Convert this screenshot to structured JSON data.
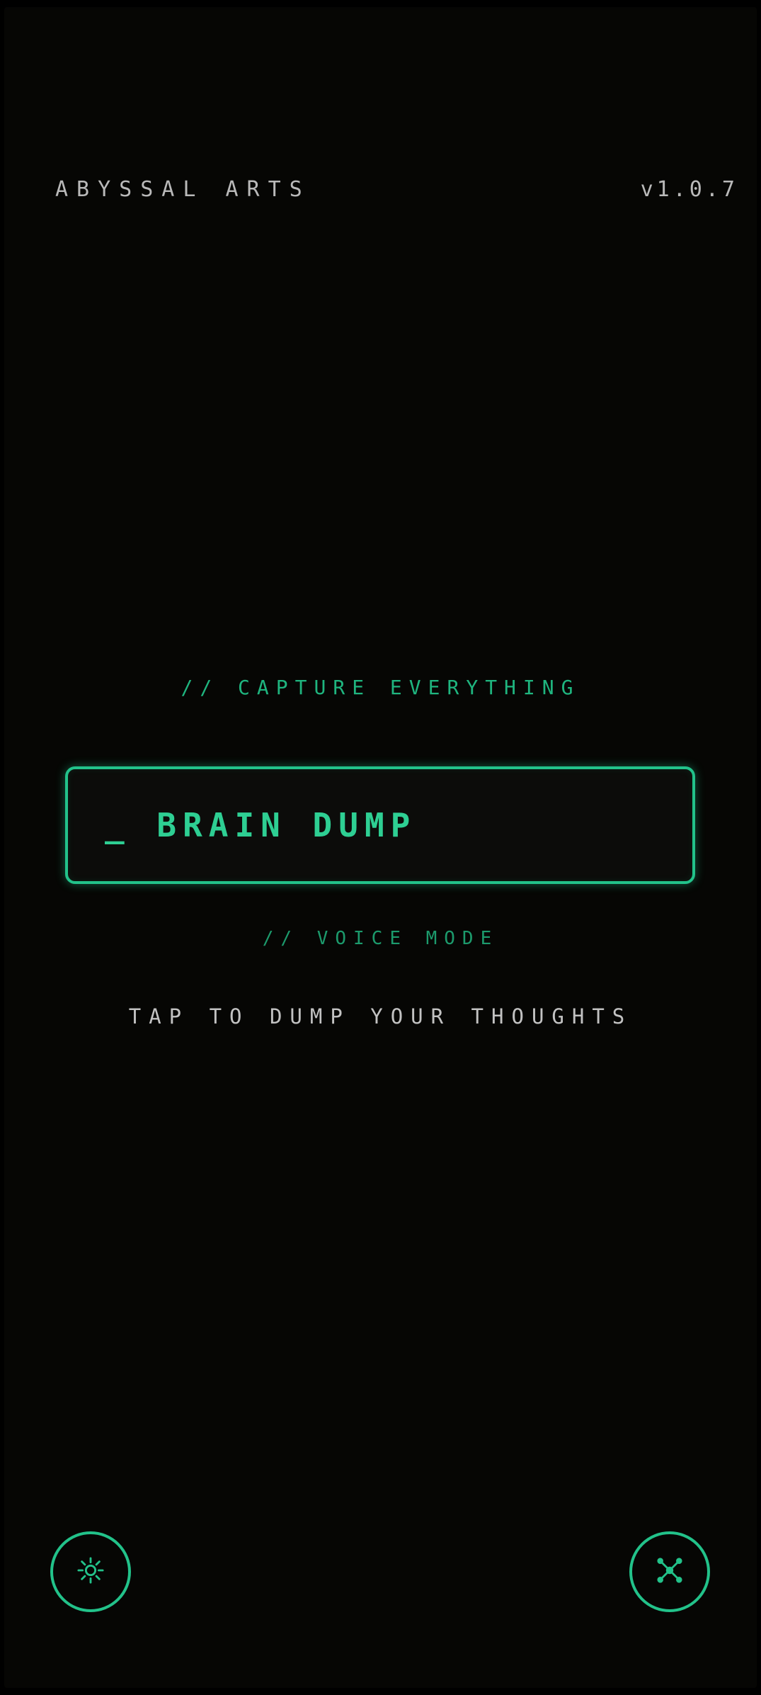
{
  "header": {
    "brand": "ABYSSAL ARTS",
    "version": "v1.0.7"
  },
  "main": {
    "tagline": "// CAPTURE EVERYTHING",
    "primary_button_label": "_ BRAIN DUMP",
    "voice_mode_label": "// VOICE MODE",
    "hint": "TAP TO DUMP YOUR THOUGHTS"
  },
  "footer": {
    "left_button_icon": "sun-icon",
    "right_button_icon": "network-icon"
  },
  "colors": {
    "background": "#060604",
    "accent": "#22c28a",
    "text_muted": "#b9b9b9"
  }
}
